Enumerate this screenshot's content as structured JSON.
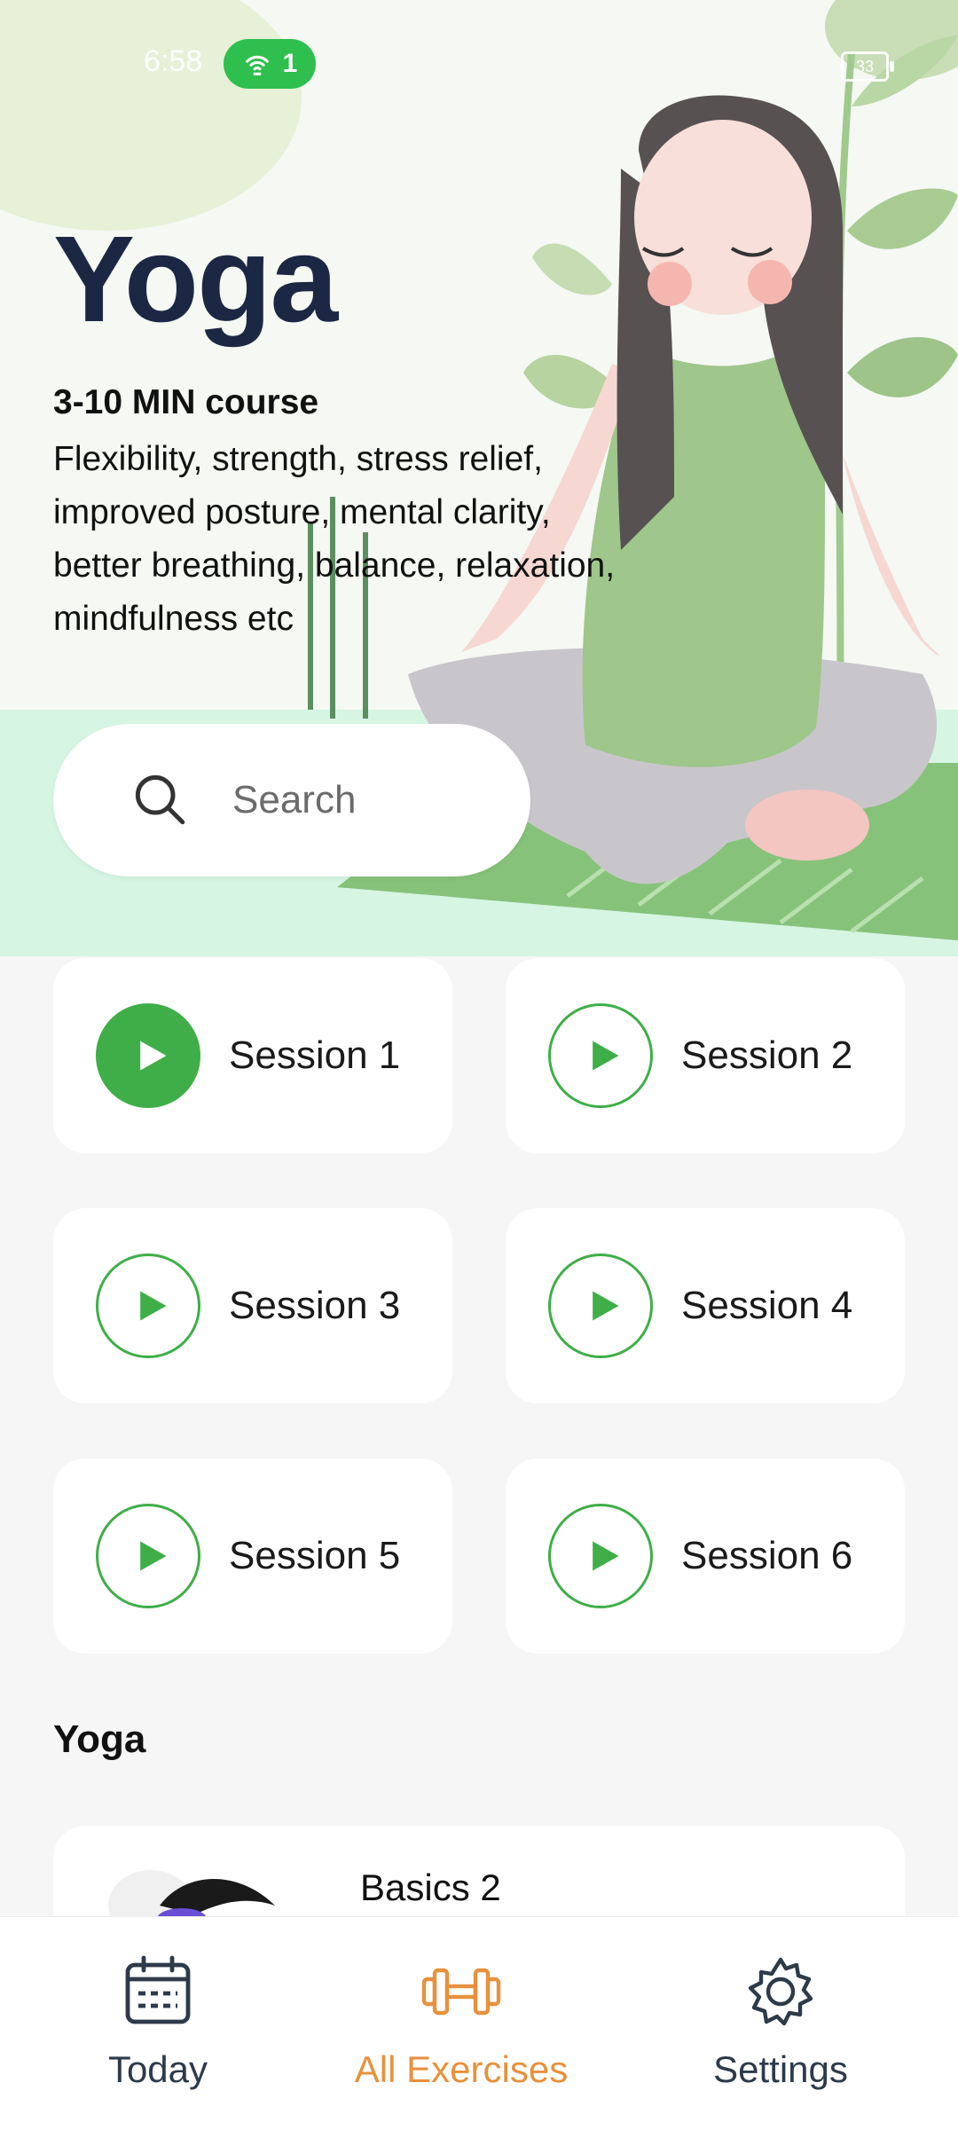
{
  "status": {
    "time": "6:58",
    "hotspot_count": "1",
    "battery": "33"
  },
  "hero": {
    "title": "Yoga",
    "subtitle": "3-10 MIN course",
    "description": "Flexibility, strength, stress relief, improved posture, mental clarity, better breathing, balance, relaxation, mindfulness etc"
  },
  "search": {
    "placeholder": "Search"
  },
  "sessions": [
    {
      "label": "Session 1",
      "active": true
    },
    {
      "label": "Session 2",
      "active": false
    },
    {
      "label": "Session 3",
      "active": false
    },
    {
      "label": "Session 4",
      "active": false
    },
    {
      "label": "Session 5",
      "active": false
    },
    {
      "label": "Session 6",
      "active": false
    }
  ],
  "section": {
    "title": "Yoga"
  },
  "lessons": [
    {
      "title": "Basics 2"
    }
  ],
  "nav": {
    "items": [
      {
        "label": "Today",
        "icon": "calendar-icon"
      },
      {
        "label": "All Exercises",
        "icon": "dumbbell-icon"
      },
      {
        "label": "Settings",
        "icon": "gear-icon"
      }
    ],
    "active_index": 1
  },
  "colors": {
    "accent_green": "#3fae48",
    "active_orange": "#e8913d",
    "title_navy": "#1c2744"
  }
}
